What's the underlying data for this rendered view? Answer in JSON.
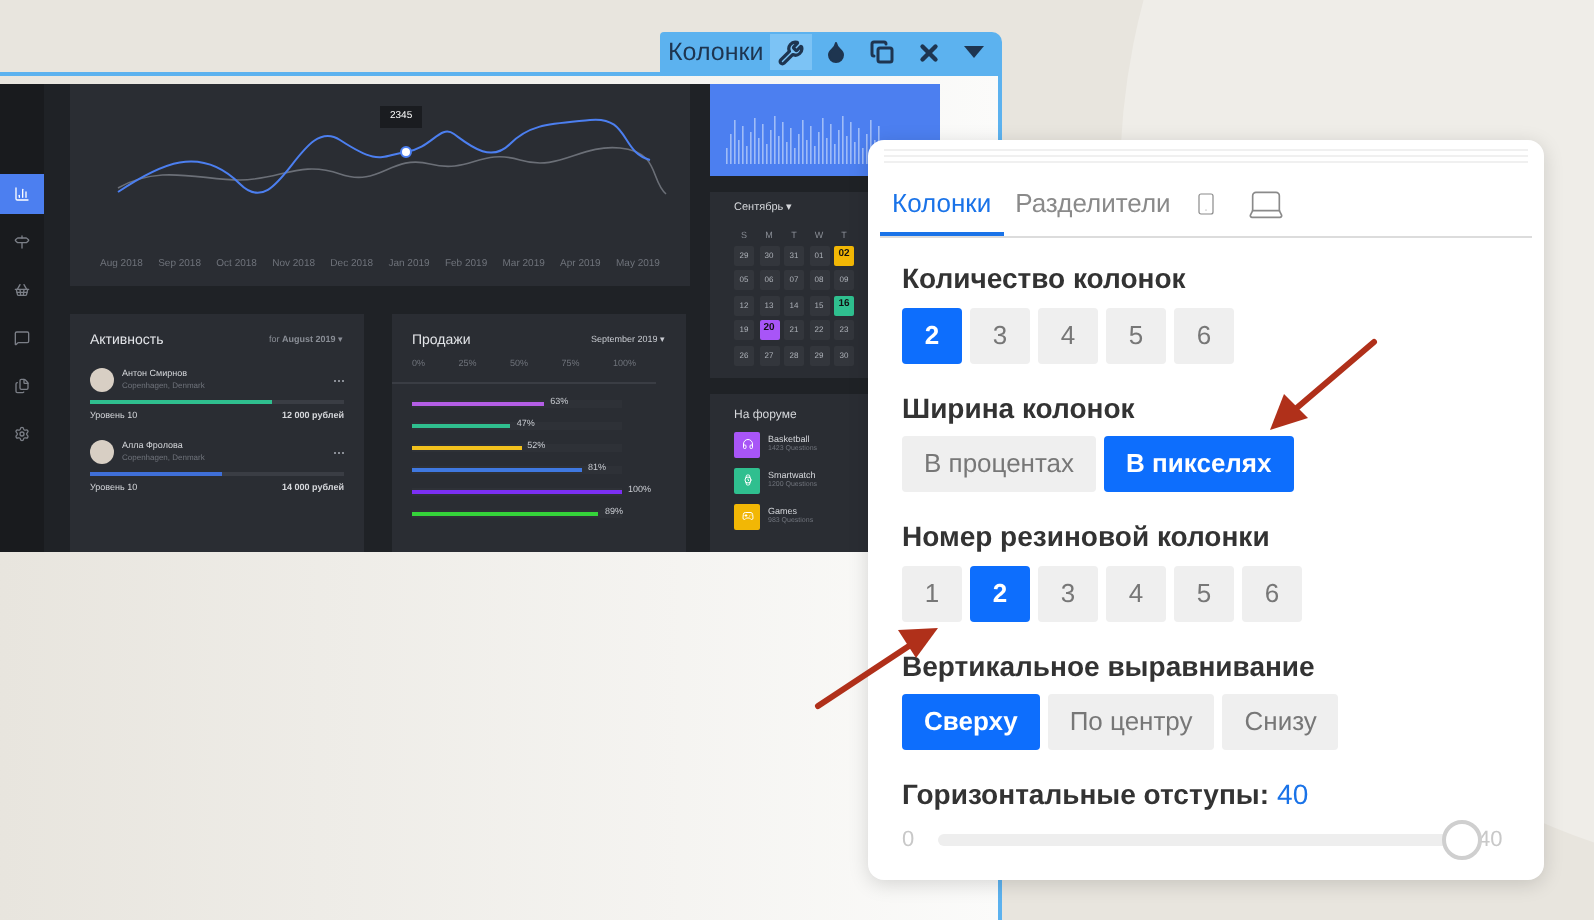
{
  "editor_toolbar": {
    "title": "Колонки",
    "tools": [
      {
        "kind": "wrench",
        "selected": true
      },
      {
        "kind": "drop",
        "selected": false
      },
      {
        "kind": "copy",
        "selected": false
      },
      {
        "kind": "close",
        "selected": false
      },
      {
        "kind": "caret",
        "selected": false
      }
    ]
  },
  "dashboard": {
    "sidebar_items": [
      {
        "kind": "chart",
        "selected": true
      },
      {
        "kind": "signpost",
        "selected": false
      },
      {
        "kind": "basket",
        "selected": false
      },
      {
        "kind": "chat",
        "selected": false
      },
      {
        "kind": "documents",
        "selected": false
      },
      {
        "kind": "settings",
        "selected": false
      }
    ],
    "line_chart": {
      "tooltip": "2345",
      "months": [
        "Aug 2018",
        "Sep 2018",
        "Oct 2018",
        "Nov 2018",
        "Dec 2018",
        "Jan 2019",
        "Feb 2019",
        "Mar 2019",
        "Apr 2019",
        "May 2019"
      ]
    },
    "activity": {
      "title": "Активность",
      "period": "for **August 2019** ▾",
      "people": [
        {
          "name": "Антон Смирнов",
          "location": "Copenhagen, Denmark",
          "rank": "Уровень 10",
          "amount": "12 000 рублей",
          "level": 0.72,
          "color": "#2fbf8f"
        },
        {
          "name": "Алла Фролова",
          "location": "Copenhagen, Denmark",
          "rank": "Уровень 10",
          "amount": "14 000 рублей",
          "level": 0.52,
          "color": "#3f6fd8"
        }
      ]
    },
    "sales": {
      "title": "Продажи",
      "period": "September 2019 ▾",
      "scale": [
        "0%",
        "25%",
        "50%",
        "75%",
        "100%"
      ],
      "bars": [
        {
          "label": "63%",
          "level": 0.63,
          "color": "#b45ee6"
        },
        {
          "label": "47%",
          "level": 0.47,
          "color": "#2fbf8f"
        },
        {
          "label": "52%",
          "level": 0.52,
          "color": "#f2c11d"
        },
        {
          "label": "81%",
          "level": 0.81,
          "color": "#3f78e0"
        },
        {
          "label": "100%",
          "level": 1,
          "color": "#7b2ff2"
        },
        {
          "label": "89%",
          "level": 0.89,
          "color": "#35d43a"
        }
      ]
    },
    "calendar": {
      "month": "Сентябрь ▾",
      "weekdays": [
        "S",
        "M",
        "T",
        "W",
        "T"
      ],
      "weeks": [
        [
          {
            "day": "29",
            "highlighted": false,
            "color": "#33363c"
          },
          {
            "day": "30",
            "highlighted": false,
            "color": "#33363c"
          },
          {
            "day": "31",
            "highlighted": false,
            "color": "#33363c"
          },
          {
            "day": "01",
            "highlighted": false,
            "color": "#33363c"
          },
          {
            "day": "02",
            "highlighted": true,
            "color": "#f2b705"
          }
        ],
        [
          {
            "day": "05",
            "highlighted": false,
            "color": "#33363c"
          },
          {
            "day": "06",
            "highlighted": false,
            "color": "#33363c"
          },
          {
            "day": "07",
            "highlighted": false,
            "color": "#33363c"
          },
          {
            "day": "08",
            "highlighted": false,
            "color": "#33363c"
          },
          {
            "day": "09",
            "highlighted": false,
            "color": "#33363c"
          }
        ],
        [
          {
            "day": "12",
            "highlighted": false,
            "color": "#33363c"
          },
          {
            "day": "13",
            "highlighted": false,
            "color": "#33363c"
          },
          {
            "day": "14",
            "highlighted": false,
            "color": "#33363c"
          },
          {
            "day": "15",
            "highlighted": false,
            "color": "#33363c"
          },
          {
            "day": "16",
            "highlighted": true,
            "color": "#2fbf8f"
          }
        ],
        [
          {
            "day": "19",
            "highlighted": false,
            "color": "#33363c"
          },
          {
            "day": "20",
            "highlighted": true,
            "color": "#a855f7"
          },
          {
            "day": "21",
            "highlighted": false,
            "color": "#33363c"
          },
          {
            "day": "22",
            "highlighted": false,
            "color": "#33363c"
          },
          {
            "day": "23",
            "highlighted": false,
            "color": "#33363c"
          }
        ],
        [
          {
            "day": "26",
            "highlighted": false,
            "color": "#33363c"
          },
          {
            "day": "27",
            "highlighted": false,
            "color": "#33363c"
          },
          {
            "day": "28",
            "highlighted": false,
            "color": "#33363c"
          },
          {
            "day": "29",
            "highlighted": false,
            "color": "#33363c"
          },
          {
            "day": "30",
            "highlighted": false,
            "color": "#33363c"
          }
        ]
      ]
    },
    "forum": {
      "title": "На форуме",
      "topics": [
        {
          "kind": "headphones",
          "name": "Basketball",
          "count": "1423 Questions",
          "color": "#a855f7"
        },
        {
          "kind": "watch",
          "name": "Smartwatch",
          "count": "1200 Questions",
          "color": "#2fbf8f"
        },
        {
          "kind": "gamepad",
          "name": "Games",
          "count": "983 Questions",
          "color": "#f2b705"
        }
      ]
    }
  },
  "settings_panel": {
    "tabs": [
      {
        "kind": "text",
        "label": "Колонки",
        "selected": true
      },
      {
        "kind": "text",
        "label": "Разделители",
        "selected": false
      },
      {
        "kind": "phone",
        "selected": false
      },
      {
        "kind": "laptop",
        "selected": false
      }
    ],
    "groups": [
      {
        "title": "Количество колонок",
        "options": [
          {
            "label": "2",
            "selected": true
          },
          {
            "label": "3",
            "selected": false
          },
          {
            "label": "4",
            "selected": false
          },
          {
            "label": "5",
            "selected": false
          },
          {
            "label": "6",
            "selected": false
          }
        ]
      },
      {
        "title": "Ширина колонок",
        "options": [
          {
            "label": "В процентах",
            "selected": false
          },
          {
            "label": "В пикселях",
            "selected": true
          }
        ]
      },
      {
        "title": "Номер резиновой колонки",
        "options": [
          {
            "label": "1",
            "selected": false
          },
          {
            "label": "2",
            "selected": true
          },
          {
            "label": "3",
            "selected": false
          },
          {
            "label": "4",
            "selected": false
          },
          {
            "label": "5",
            "selected": false
          },
          {
            "label": "6",
            "selected": false
          }
        ]
      },
      {
        "title": "Вертикальное выравнивание",
        "options": [
          {
            "label": "Сверху",
            "selected": true
          },
          {
            "label": "По центру",
            "selected": false
          },
          {
            "label": "Снизу",
            "selected": false
          }
        ]
      }
    ],
    "slider": {
      "label": "Горизонтальные отступы:",
      "value": "40",
      "min": "0",
      "max": "40",
      "level": 1
    }
  }
}
